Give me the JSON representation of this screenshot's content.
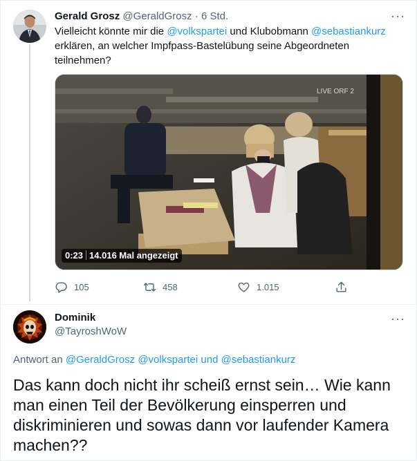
{
  "tweet1": {
    "author_name": "Gerald Grosz",
    "author_handle": "@GeraldGrosz",
    "separator": "·",
    "time": "6 Std.",
    "text_1": "Vielleicht könnte mir die ",
    "mention_1": "@volkspartei",
    "text_2": " und Klubobmann ",
    "mention_2": "@sebastiankurz",
    "text_3": " erklären, an welcher Impfpass-Bastelübung seine Abgeordneten teilnehmen?",
    "video_time": "0:23",
    "video_views": "14.016 Mal angezeigt",
    "video_overlay_text": "LIVE ORF 2",
    "replies": "105",
    "retweets": "458",
    "likes": "1.015",
    "more_label": "···"
  },
  "tweet2": {
    "author_name": "Dominik",
    "author_handle": "@TayroshWoW",
    "more_label": "···",
    "reply_prefix": "Antwort an ",
    "reply_mention_1": "@GeraldGrosz",
    "reply_mention_2": "@volkspartei",
    "reply_and": " und ",
    "reply_mention_3": "@sebastiankurz",
    "text": "Das kann doch nicht ihr scheiß ernst sein… Wie kann man einen Teil der Bevölkerung einsperren und diskriminieren und sowas dann vor laufender Kamera machen??"
  },
  "icons": {
    "reply": "reply-icon",
    "retweet": "retweet-icon",
    "like": "heart-icon",
    "share": "share-icon",
    "more": "more-icon"
  },
  "colors": {
    "link": "#1d9bf0",
    "secondary_text": "#536471",
    "primary_text": "#0f1419"
  }
}
